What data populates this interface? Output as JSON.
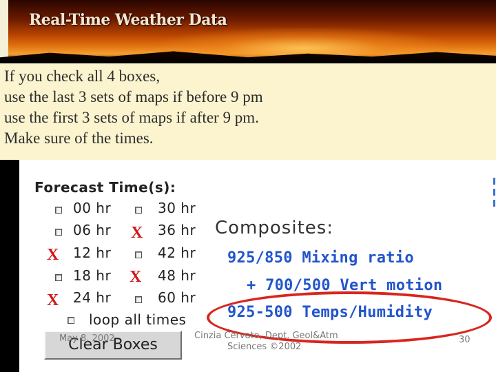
{
  "header": {
    "title": "Real-Time Weather Data"
  },
  "note": {
    "lines": [
      "If you check all 4 boxes,",
      "use the last 3 sets of maps if before 9 pm",
      "use the first 3 sets of maps if after 9 pm.",
      "Make sure of the times."
    ]
  },
  "forecast": {
    "title": "Forecast Time(s):",
    "left_col": [
      "00 hr",
      "06 hr",
      "12 hr",
      "18 hr",
      "24 hr"
    ],
    "right_col": [
      "30 hr",
      "36 hr",
      "42 hr",
      "48 hr",
      "60 hr"
    ],
    "marked": {
      "left": [
        false,
        false,
        true,
        false,
        true
      ],
      "right": [
        false,
        true,
        false,
        true,
        false
      ]
    },
    "mark_char": "X",
    "loop_label": "loop all times"
  },
  "composites": {
    "title": "Composites:",
    "link1": "925/850 Mixing ratio",
    "link2": "+ 700/500 Vert motion",
    "link3": "925-500 Temps/Humidity"
  },
  "buttons": {
    "clear": "Clear Boxes"
  },
  "footer": {
    "date": "May 8, 2002",
    "credit_line1": "Cinzia Cervato, Dept. Geol&Atm",
    "credit_line2": "Sciences ©2002",
    "page": "30"
  },
  "colors": {
    "mark": "#d01818",
    "link": "#2255cc",
    "highlight": "#d8261e",
    "note_bg": "#fbf4cf"
  }
}
